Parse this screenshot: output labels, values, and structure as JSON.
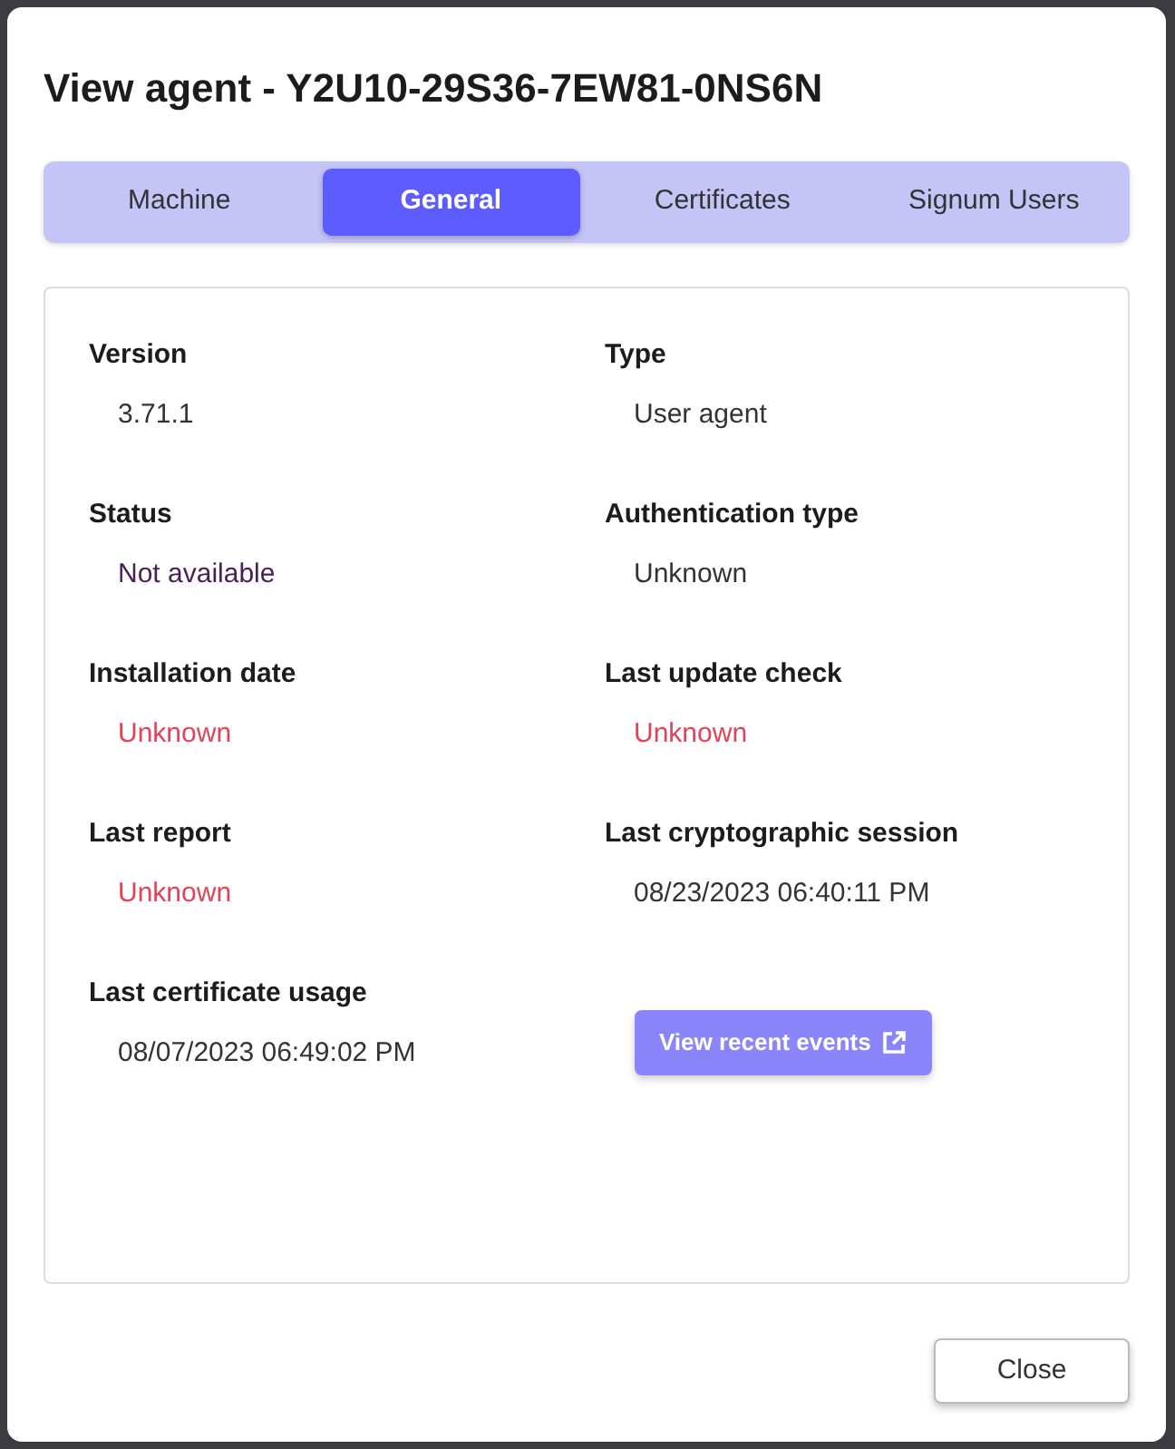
{
  "dialog": {
    "title": "View agent - Y2U10-29S36-7EW81-0NS6N"
  },
  "tabs": [
    {
      "label": "Machine",
      "selected": false
    },
    {
      "label": "General",
      "selected": true
    },
    {
      "label": "Certificates",
      "selected": false
    },
    {
      "label": "Signum Users",
      "selected": false
    }
  ],
  "fields": [
    {
      "label": "Version",
      "value": "3.71.1",
      "kind": "plain"
    },
    {
      "label": "Type",
      "value": "User agent",
      "kind": "plain"
    },
    {
      "label": "Status",
      "value": "Not available",
      "kind": "muted"
    },
    {
      "label": "Authentication type",
      "value": "Unknown",
      "kind": "plain"
    },
    {
      "label": "Installation date",
      "value": "Unknown",
      "kind": "alert"
    },
    {
      "label": "Last update check",
      "value": "Unknown",
      "kind": "alert"
    },
    {
      "label": "Last report",
      "value": "Unknown",
      "kind": "alert"
    },
    {
      "label": "Last cryptographic session",
      "value": "08/23/2023 06:40:11 PM",
      "kind": "plain"
    },
    {
      "label": "Last certificate usage",
      "value": "08/07/2023 06:49:02 PM",
      "kind": "plain"
    }
  ],
  "events_button": {
    "label": "View recent events",
    "disabled": true
  },
  "footer": {
    "close_button": "Close"
  }
}
